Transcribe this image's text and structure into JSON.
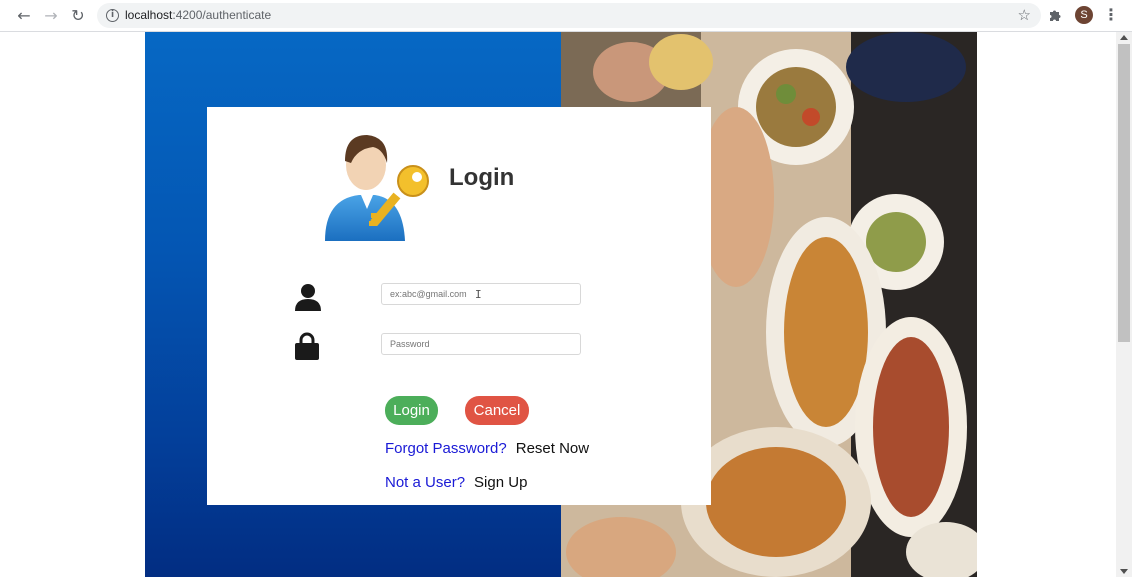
{
  "browser": {
    "url_host": "localhost",
    "url_path": ":4200/authenticate",
    "back_icon": "back-arrow-icon",
    "forward_icon": "forward-arrow-icon",
    "reload_icon": "reload-icon",
    "profile_initial": "S",
    "profile_color": "#6d4433"
  },
  "login": {
    "title": "Login",
    "email_placeholder": "ex:abc@gmail.com",
    "password_placeholder": "Password",
    "login_button": "Login",
    "cancel_button": "Cancel",
    "forgot_label": "Forgot Password?",
    "reset_link": "Reset Now",
    "not_user_label": "Not a User?",
    "signup_link": "Sign Up"
  },
  "colors": {
    "login_button": "#4cae5a",
    "cancel_button": "#e05444",
    "link_blue": "#1a1ad6",
    "panel_blue": "#0456b3"
  }
}
